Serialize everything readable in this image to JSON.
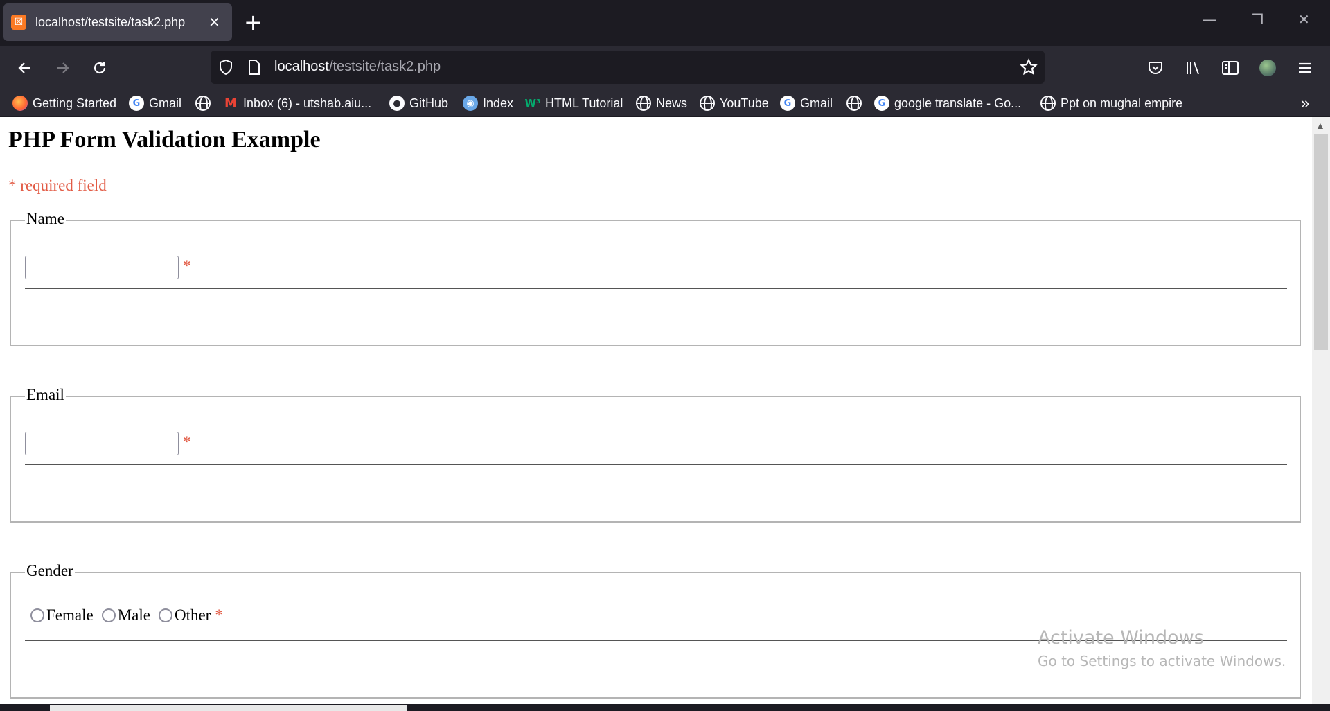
{
  "browser": {
    "tab": {
      "title": "localhost/testsite/task2.php",
      "favicon": "xampp-icon"
    },
    "url": {
      "host": "localhost",
      "path": "/testsite/task2.php"
    }
  },
  "bookmarks": [
    {
      "label": "Getting Started",
      "icon": "firefox-icon"
    },
    {
      "label": "Gmail",
      "icon": "google-icon"
    },
    {
      "label": "",
      "icon": "globe-icon"
    },
    {
      "label": "Inbox (6) - utshab.aiu...",
      "icon": "gmail-icon"
    },
    {
      "label": "GitHub",
      "icon": "github-icon"
    },
    {
      "label": "Index",
      "icon": "index-icon"
    },
    {
      "label": "HTML Tutorial",
      "icon": "w3schools-icon"
    },
    {
      "label": "News",
      "icon": "globe-icon"
    },
    {
      "label": "YouTube",
      "icon": "globe-icon"
    },
    {
      "label": "Gmail",
      "icon": "google-icon"
    },
    {
      "label": "",
      "icon": "globe-icon"
    },
    {
      "label": "google translate - Go...",
      "icon": "google-icon"
    },
    {
      "label": "Ppt on mughal empire",
      "icon": "globe-icon"
    }
  ],
  "page": {
    "heading": "PHP Form Validation Example",
    "required_note": "* required field",
    "required_star": "*",
    "fieldsets": {
      "name": {
        "legend": "Name",
        "value": ""
      },
      "email": {
        "legend": "Email",
        "value": ""
      },
      "gender": {
        "legend": "Gender",
        "options": [
          "Female",
          "Male",
          "Other"
        ]
      }
    }
  },
  "watermark": {
    "line1": "Activate Windows",
    "line2": "Go to Settings to activate Windows."
  },
  "colors": {
    "required": "#e25b45",
    "tab_bg": "#42414d",
    "toolbar_bg": "#2b2a33"
  }
}
